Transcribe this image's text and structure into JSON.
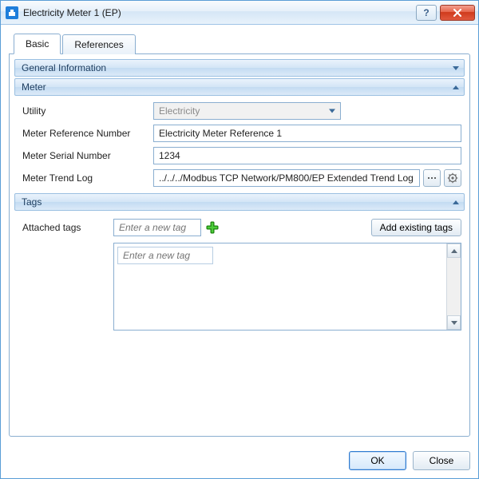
{
  "window": {
    "title": "Electricity Meter 1 (EP)"
  },
  "tabs": {
    "basic": "Basic",
    "references": "References"
  },
  "sections": {
    "general": {
      "title": "General Information"
    },
    "meter": {
      "title": "Meter",
      "utility_label": "Utility",
      "utility_value": "Electricity",
      "ref_num_label": "Meter Reference Number",
      "ref_num_value": "Electricity Meter Reference 1",
      "serial_label": "Meter Serial Number",
      "serial_value": "1234",
      "trend_label": "Meter Trend Log",
      "trend_value": "../../../Modbus TCP Network/PM800/EP Extended Trend Log"
    },
    "tags": {
      "title": "Tags",
      "attached_label": "Attached tags",
      "new_tag_placeholder": "Enter a new tag",
      "list_placeholder": "Enter a new tag",
      "add_existing_label": "Add existing tags"
    }
  },
  "footer": {
    "ok": "OK",
    "close": "Close"
  }
}
